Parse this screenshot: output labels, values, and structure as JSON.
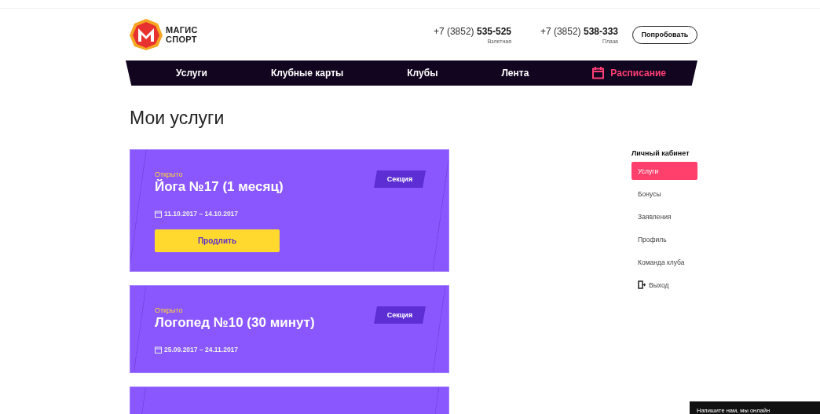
{
  "logo": {
    "line1": "МАГИС",
    "line2": "СПОРТ"
  },
  "phones": [
    {
      "prefix": "+7 (3852)",
      "number": "535-525",
      "place": "Взлетная"
    },
    {
      "prefix": "+7 (3852)",
      "number": "538-333",
      "place": "Плаза"
    }
  ],
  "try_button": "Попробовать",
  "nav": [
    {
      "label": "Услуги",
      "kind": "plain"
    },
    {
      "label": "Клубные карты",
      "kind": "plain"
    },
    {
      "label": "Клубы",
      "kind": "plain"
    },
    {
      "label": "Лента",
      "kind": "plain"
    },
    {
      "label": "Расписание",
      "kind": "accent"
    }
  ],
  "page_title": "Мои услуги",
  "cards": [
    {
      "kind": "full",
      "status": "Открыто",
      "title": "Йога №17 (1 месяц)",
      "badge": "Секция",
      "dates": "11.10.2017 – 14.10.2017",
      "action": "Продлить"
    },
    {
      "kind": "full",
      "status": "Открыто",
      "title": "Логопед №10 (30 минут)",
      "badge": "Секция",
      "dates": "25.09.2017 – 24.11.2017"
    },
    {
      "kind": "cut"
    }
  ],
  "sidebar": {
    "title": "Личный кабинет",
    "items": [
      {
        "label": "Услуги",
        "selected": true,
        "kind": "link"
      },
      {
        "label": "Бонусы",
        "selected": false,
        "kind": "link"
      },
      {
        "label": "Заявления",
        "selected": false,
        "kind": "link"
      },
      {
        "label": "Профиль",
        "selected": false,
        "kind": "link"
      },
      {
        "label": "Команда клуба",
        "selected": false,
        "kind": "link"
      },
      {
        "label": "Выход",
        "selected": false,
        "kind": "exit"
      }
    ]
  },
  "chat": {
    "label": "Напишите нам, мы онлайн"
  }
}
